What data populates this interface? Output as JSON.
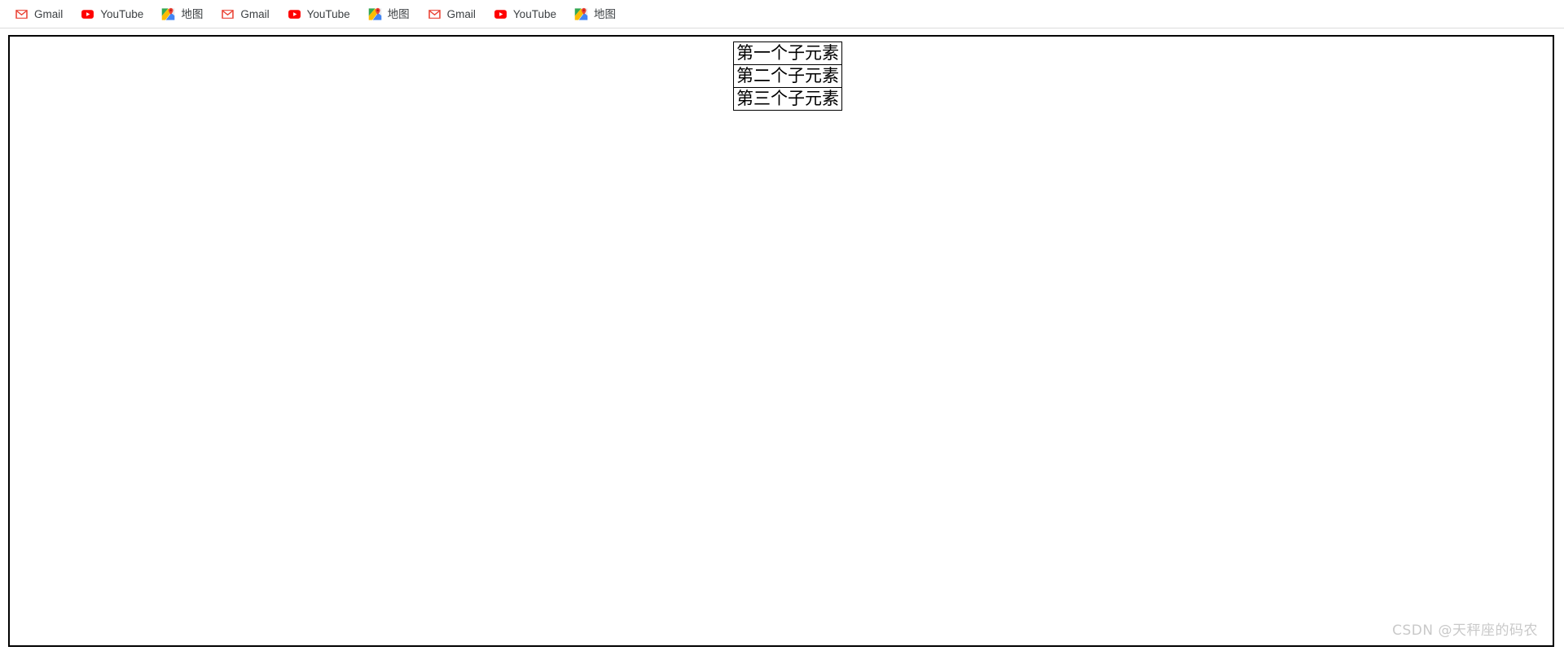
{
  "browser": {
    "bookmark_bar": {
      "items": [
        {
          "label": "Gmail",
          "icon": "gmail-icon"
        },
        {
          "label": "YouTube",
          "icon": "youtube-icon"
        },
        {
          "label": "地图",
          "icon": "google-maps-icon"
        },
        {
          "label": "Gmail",
          "icon": "gmail-icon"
        },
        {
          "label": "YouTube",
          "icon": "youtube-icon"
        },
        {
          "label": "地图",
          "icon": "google-maps-icon"
        },
        {
          "label": "Gmail",
          "icon": "gmail-icon"
        },
        {
          "label": "YouTube",
          "icon": "youtube-icon"
        },
        {
          "label": "地图",
          "icon": "google-maps-icon"
        }
      ]
    }
  },
  "page": {
    "flex_container": {
      "children": [
        {
          "label": "第一个子元素"
        },
        {
          "label": "第二个子元素"
        },
        {
          "label": "第三个子元素"
        }
      ]
    },
    "watermark": "CSDN @天秤座的码农"
  },
  "colors": {
    "gmail_red": "#EA4335",
    "youtube_red": "#FF0000",
    "border_black": "#000000",
    "bookmark_text": "#3C4043",
    "watermark_gray": "#C9C9C9",
    "separator_gray": "#DCDCDC"
  }
}
